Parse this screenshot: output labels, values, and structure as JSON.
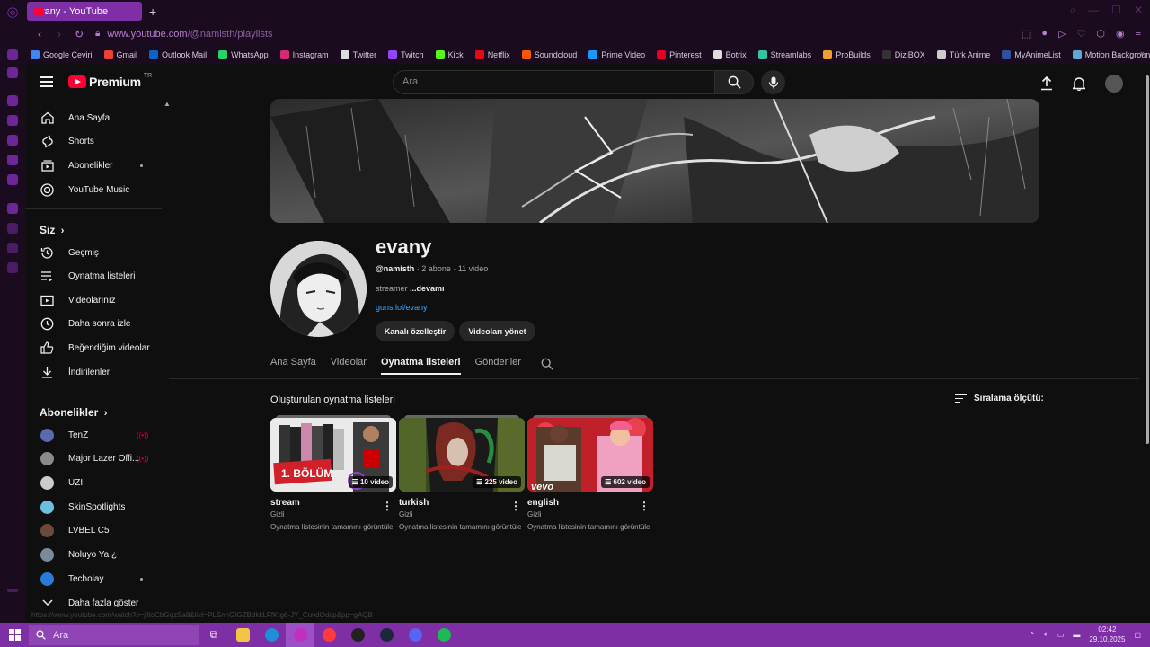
{
  "browser": {
    "tab_title": "evany - YouTube",
    "url_host": "www.youtube.com",
    "url_path": "/@namisth/playlists",
    "bookmarks": [
      {
        "label": "Google Çeviri",
        "color": "#4285f4"
      },
      {
        "label": "Gmail",
        "color": "#ea4335"
      },
      {
        "label": "Outlook Mail",
        "color": "#0a64c8"
      },
      {
        "label": "WhatsApp",
        "color": "#25d366"
      },
      {
        "label": "Instagram",
        "color": "#d62976"
      },
      {
        "label": "Twitter",
        "color": "#dddddd"
      },
      {
        "label": "Twitch",
        "color": "#9146ff"
      },
      {
        "label": "Kick",
        "color": "#53fc18"
      },
      {
        "label": "Netflix",
        "color": "#e50914"
      },
      {
        "label": "Soundcloud",
        "color": "#ff5500"
      },
      {
        "label": "Prime Video",
        "color": "#1a98ff"
      },
      {
        "label": "Pinterest",
        "color": "#e60023"
      },
      {
        "label": "Botrix",
        "color": "#dddddd"
      },
      {
        "label": "Streamlabs",
        "color": "#31c3a2"
      },
      {
        "label": "ProBuilds",
        "color": "#f0a030"
      },
      {
        "label": "DiziBOX",
        "color": "#333333"
      },
      {
        "label": "Türk Anime",
        "color": "#cccccc"
      },
      {
        "label": "MyAnimeList",
        "color": "#2e51a2"
      },
      {
        "label": "Motion Background",
        "color": "#5fa8d3"
      }
    ]
  },
  "header": {
    "logo_text": "Premium",
    "logo_region": "TR",
    "search_placeholder": "Ara"
  },
  "sidebar": {
    "main": [
      {
        "label": "Ana Sayfa",
        "icon": "home-icon"
      },
      {
        "label": "Shorts",
        "icon": "shorts-icon"
      },
      {
        "label": "Abonelikler",
        "icon": "subscriptions-icon"
      },
      {
        "label": "YouTube Music",
        "icon": "youtube-music-icon"
      }
    ],
    "you_title": "Siz",
    "you": [
      {
        "label": "Geçmiş",
        "icon": "history-icon"
      },
      {
        "label": "Oynatma listeleri",
        "icon": "playlists-icon"
      },
      {
        "label": "Videolarınız",
        "icon": "your-videos-icon"
      },
      {
        "label": "Daha sonra izle",
        "icon": "watch-later-icon"
      },
      {
        "label": "Beğendiğim videolar",
        "icon": "liked-icon"
      },
      {
        "label": "İndirilenler",
        "icon": "download-icon"
      }
    ],
    "subs_title": "Abonelikler",
    "subs": [
      {
        "label": "TenZ",
        "color": "#5a6ab0"
      },
      {
        "label": "Major Lazer Offi...",
        "color": "#8a8a8a"
      },
      {
        "label": "UZI",
        "color": "#cccccc"
      },
      {
        "label": "SkinSpotlights",
        "color": "#6bc0e0"
      },
      {
        "label": "LVBEL C5",
        "color": "#6a4a3a"
      },
      {
        "label": "Noluyo Ya ¿",
        "color": "#7a8a9a"
      },
      {
        "label": "Techolay",
        "color": "#2a7ad8"
      }
    ],
    "show_more": "Daha fazla göster"
  },
  "channel": {
    "name": "evany",
    "handle": "@namisth",
    "subscribers": "2 abone",
    "videos": "11 video",
    "description": "streamer",
    "more": "...devamı",
    "link": "guns.lol/evany",
    "customize_label": "Kanalı özelleştir",
    "manage_label": "Videoları yönet"
  },
  "tabs": [
    "Ana Sayfa",
    "Videolar",
    "Oynatma listeleri",
    "Gönderiler"
  ],
  "playlists_section": {
    "title": "Oluşturulan oynatma listeleri",
    "sort_label": "Sıralama ölçütü:",
    "items": [
      {
        "title": "stream",
        "count": "10 video",
        "privacy": "Gizli",
        "full": "Oynatma listesinin tamamını görüntüle",
        "overlay": "1. BÖLÜM"
      },
      {
        "title": "turkish",
        "count": "225 video",
        "privacy": "Gizli",
        "full": "Oynatma listesinin tamamını görüntüle"
      },
      {
        "title": "english",
        "count": "602 video",
        "privacy": "Gizli",
        "full": "Oynatma listesinin tamamını görüntüle",
        "overlay": "vevo"
      }
    ]
  },
  "status_url": "https://www.youtube.com/watch?v=jiltoCbGqzSa8&list=PLSnhGIGZBdkkLFfKtg6-JY_CuvdOdcp&pp=gAQB",
  "taskbar": {
    "search_placeholder": "Ara",
    "time": "02:42",
    "date": "29.10.2025"
  }
}
